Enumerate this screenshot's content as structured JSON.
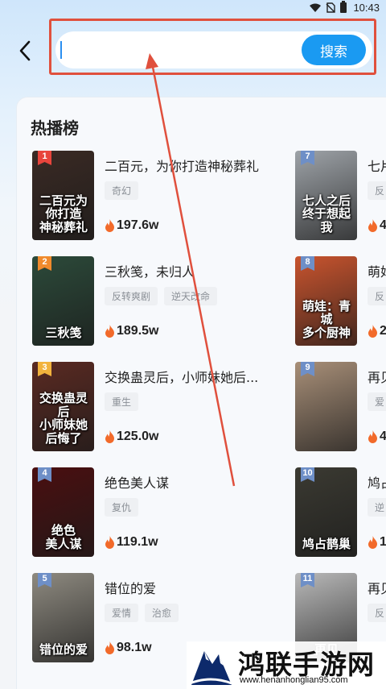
{
  "status_bar": {
    "time": "10:43"
  },
  "search": {
    "placeholder": "",
    "value": "",
    "button_label": "搜索"
  },
  "section_title": "热播榜",
  "rank_colors": {
    "1": "#e8453c",
    "2": "#f08a2c",
    "3": "#f2b33d",
    "other": "#6e8fc7"
  },
  "left_column": [
    {
      "rank": "1",
      "title": "二百元，为你打造神秘葬礼",
      "tags": [
        "奇幻"
      ],
      "heat": "197.6w",
      "poster_text": "二百元为你打造\n神秘葬礼",
      "poster_bg": "#3a2a24"
    },
    {
      "rank": "2",
      "title": "三秋笺，未归人",
      "tags": [
        "反转爽剧",
        "逆天改命"
      ],
      "heat": "189.5w",
      "poster_text": "三秋笺",
      "poster_bg": "#2c4a3a"
    },
    {
      "rank": "3",
      "title": "交换蛊灵后，小师妹她后...",
      "tags": [
        "重生"
      ],
      "heat": "125.0w",
      "poster_text": "交换蛊灵后\n小师妹她后悔了",
      "poster_bg": "#5a2a22"
    },
    {
      "rank": "4",
      "title": "绝色美人谋",
      "tags": [
        "复仇"
      ],
      "heat": "119.1w",
      "poster_text": "绝色\n美人谋",
      "poster_bg": "#4a0f10"
    },
    {
      "rank": "5",
      "title": "错位的爱",
      "tags": [
        "爱情",
        "治愈"
      ],
      "heat": "98.1w",
      "poster_text": "错位的爱",
      "poster_bg": "#8e8a80"
    }
  ],
  "right_column": [
    {
      "rank": "7",
      "title": "七片",
      "tags": [
        "反"
      ],
      "heat": "4",
      "poster_text": "七人之后\n终于想起我",
      "poster_bg": "#9ea3a8"
    },
    {
      "rank": "8",
      "title": "萌妇",
      "tags": [
        "反"
      ],
      "heat": "2",
      "poster_text": "萌娃：青城\n多个厨神",
      "poster_bg": "#c9542e"
    },
    {
      "rank": "9",
      "title": "再贝",
      "tags": [
        "爱"
      ],
      "heat": "4",
      "poster_text": "",
      "poster_bg": "#a88f78"
    },
    {
      "rank": "10",
      "title": "鸠占",
      "tags": [
        "逆"
      ],
      "heat": "1",
      "poster_text": "鸠占鹊巢",
      "poster_bg": "#3b3a32"
    },
    {
      "rank": "11",
      "title": "再贝",
      "tags": [
        "反"
      ],
      "heat": "",
      "poster_text": "再见",
      "poster_bg": "#b9b9b9"
    }
  ],
  "watermark": {
    "name": "鸿联手游网",
    "url": "www.henanhonglian95.com"
  }
}
